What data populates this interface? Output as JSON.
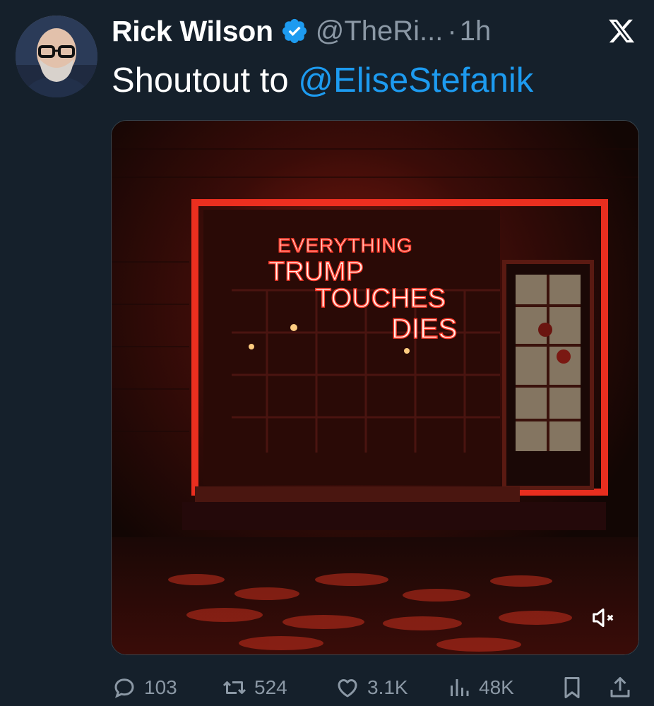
{
  "author": {
    "display_name": "Rick Wilson",
    "handle": "@TheRi...",
    "separator": "·",
    "time": "1h",
    "verified": true
  },
  "tweet": {
    "text_prefix": "Shoutout to ",
    "mention": "@EliseStefanik"
  },
  "media": {
    "type": "video",
    "muted": true,
    "neon_sign_lines": [
      "EVERYTHING",
      "TRUMP",
      "TOUCHES",
      "DIES"
    ],
    "neon_color": "#ff3a2a"
  },
  "actions": {
    "replies": "103",
    "reposts": "524",
    "likes": "3.1K",
    "views": "48K"
  },
  "colors": {
    "background": "#15202b",
    "accent": "#1d9bf0",
    "secondary_text": "#8b98a5"
  },
  "icons": [
    "x-logo-icon",
    "verified-badge-icon",
    "mute-icon",
    "reply-icon",
    "repost-icon",
    "like-icon",
    "views-icon",
    "bookmark-icon",
    "share-icon"
  ]
}
